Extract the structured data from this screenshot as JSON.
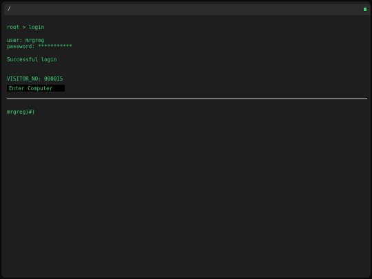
{
  "titlebar": {
    "path": "/",
    "button_icon": "green-square-icon"
  },
  "terminal": {
    "lines": {
      "root": "root > login",
      "user": "user: mrgreg",
      "password": "password: ***********",
      "status": "Successful login",
      "visitor": "VISITOR_NO: 000015"
    },
    "input": {
      "placeholder": "Enter Computer",
      "value": ""
    },
    "prompt": "mrgreg)#)"
  },
  "colors": {
    "text": "#3fd47a",
    "background": "#1e1e1e",
    "titlebar": "#2c2c2c"
  }
}
